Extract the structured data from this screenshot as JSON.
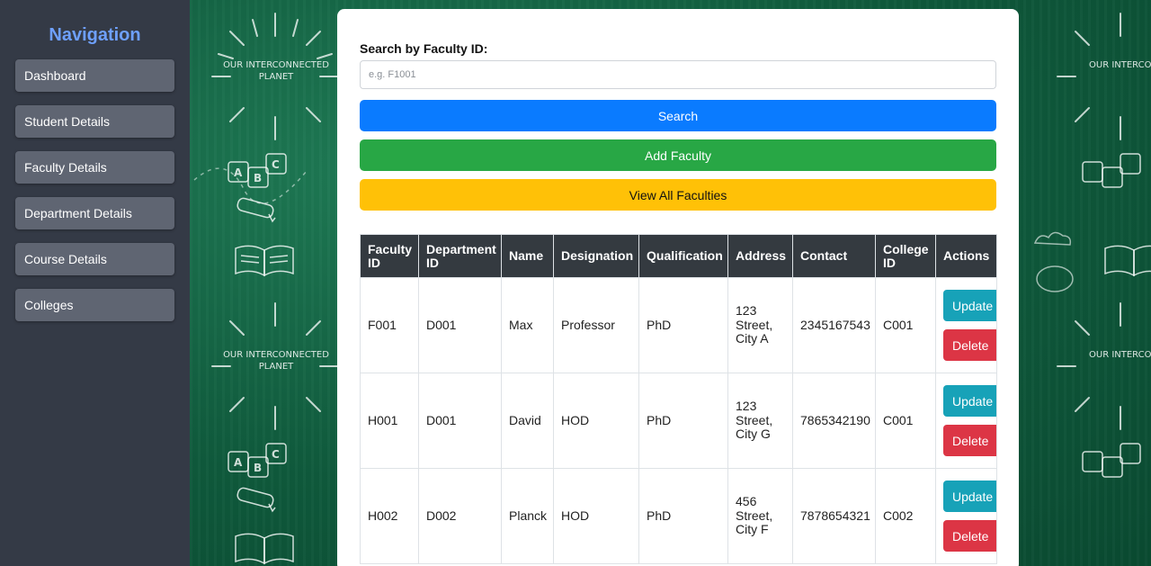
{
  "sidebar": {
    "title": "Navigation",
    "items": [
      "Dashboard",
      "Student Details",
      "Faculty Details",
      "Department Details",
      "Course Details",
      "Colleges"
    ]
  },
  "background": {
    "poster_text": "OUR INTERCONNECTED PLANET"
  },
  "search": {
    "label": "Search by Faculty ID:",
    "placeholder": "e.g. F1001",
    "value": ""
  },
  "buttons": {
    "search": "Search",
    "add": "Add Faculty",
    "view_all": "View All Faculties"
  },
  "table": {
    "headers": {
      "faculty_id": "Faculty ID",
      "department_id": "Department ID",
      "name": "Name",
      "designation": "Designation",
      "qualification": "Qualification",
      "address": "Address",
      "contact": "Contact",
      "college_id": "College ID",
      "actions": "Actions"
    },
    "rows": [
      {
        "faculty_id": "F001",
        "department_id": "D001",
        "name": "Max",
        "designation": "Professor",
        "qualification": "PhD",
        "address": "123 Street, City A",
        "contact": "2345167543",
        "college_id": "C001",
        "update": "Update",
        "delete": "Delete"
      },
      {
        "faculty_id": "H001",
        "department_id": "D001",
        "name": "David",
        "designation": "HOD",
        "qualification": "PhD",
        "address": "123 Street, City G",
        "contact": "7865342190",
        "college_id": "C001",
        "update": "Update",
        "delete": "Delete"
      },
      {
        "faculty_id": "H002",
        "department_id": "D002",
        "name": "Planck",
        "designation": "HOD",
        "qualification": "PhD",
        "address": "456 Street, City F",
        "contact": "7878654321",
        "college_id": "C002",
        "update": "Update",
        "delete": "Delete"
      }
    ]
  },
  "colors": {
    "sidebar_bg": "#343a46",
    "nav_title": "#6ea0ff",
    "primary": "#0a7bff",
    "success": "#28a745",
    "warning": "#ffc107",
    "info": "#17a2b8",
    "danger": "#dc3545",
    "table_header": "#343a40"
  }
}
